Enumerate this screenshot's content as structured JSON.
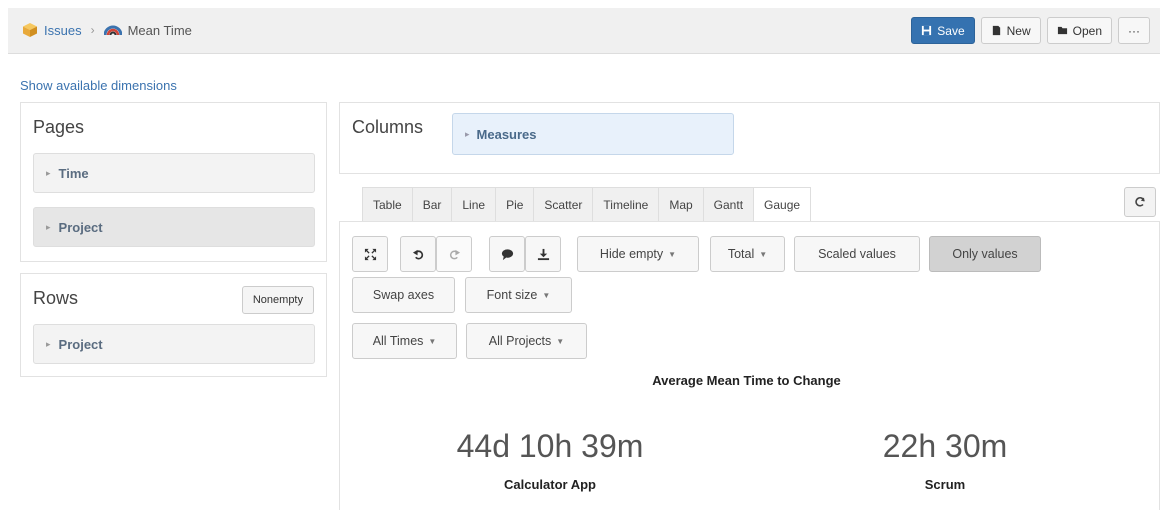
{
  "breadcrumb": {
    "root": "Issues",
    "current": "Mean Time"
  },
  "toolbar": {
    "save": "Save",
    "new": "New",
    "open": "Open",
    "more": "···"
  },
  "show_dimensions": "Show available dimensions",
  "pages": {
    "title": "Pages",
    "items": [
      "Time",
      "Project"
    ]
  },
  "rows": {
    "title": "Rows",
    "nonempty": "Nonempty",
    "items": [
      "Project"
    ]
  },
  "columns": {
    "title": "Columns",
    "items": [
      "Measures"
    ]
  },
  "tabs": [
    "Table",
    "Bar",
    "Line",
    "Pie",
    "Scatter",
    "Timeline",
    "Map",
    "Gantt",
    "Gauge"
  ],
  "active_tab": "Gauge",
  "controls": {
    "hide_empty": "Hide empty",
    "total": "Total",
    "scaled_values": "Scaled values",
    "only_values": "Only values",
    "swap_axes": "Swap axes",
    "font_size": "Font size",
    "all_times": "All Times",
    "all_projects": "All Projects"
  },
  "chart": {
    "title": "Average Mean Time to Change",
    "gauges": [
      {
        "value": "44d 10h 39m",
        "label": "Calculator App"
      },
      {
        "value": "22h 30m",
        "label": "Scrum"
      }
    ]
  },
  "colors": {
    "primary": "#3572b0",
    "link": "#3b73af",
    "measures_bg": "#e8f1fb"
  }
}
